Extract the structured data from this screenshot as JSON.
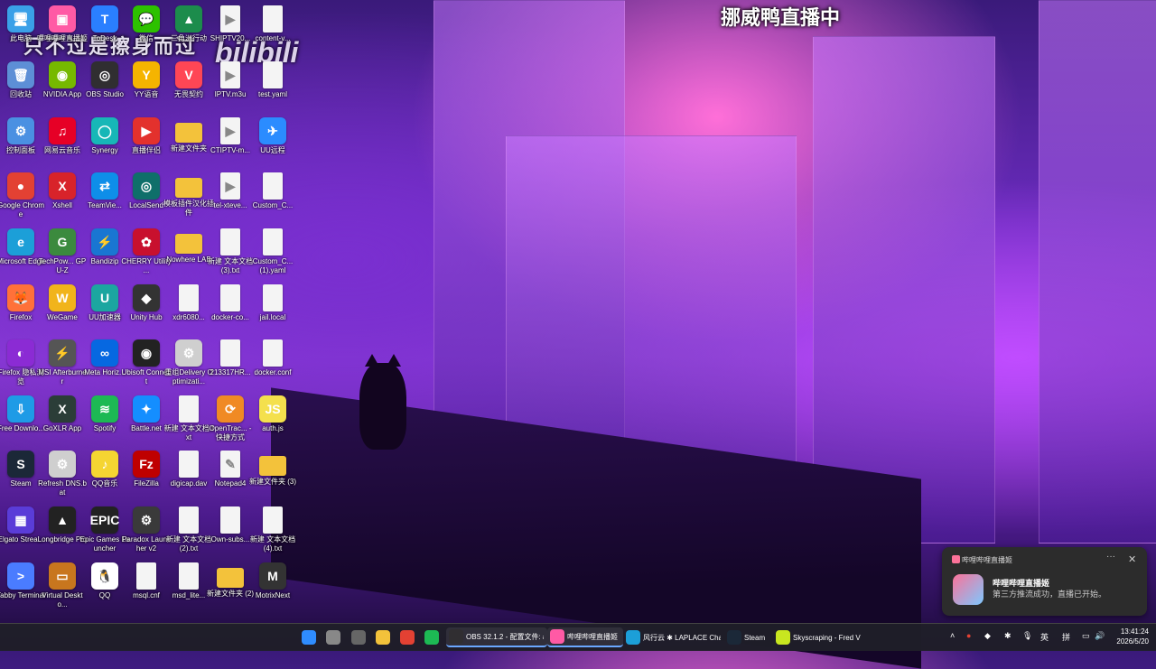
{
  "overlay": {
    "bili_caption": "只不过是擦身而过",
    "bili_logo": "bilibili",
    "live_title": "挪威鸭直播中"
  },
  "desktop_icons": [
    {
      "label": "此电脑",
      "color": "#3aa0e8",
      "glyph": "🖥",
      "type": "app"
    },
    {
      "label": "回收站",
      "color": "#5d8fd6",
      "glyph": "🗑",
      "type": "app"
    },
    {
      "label": "控制面板",
      "color": "#4a90e2",
      "glyph": "⚙",
      "type": "app"
    },
    {
      "label": "Google Chrome",
      "color": "#e34133",
      "glyph": "●",
      "type": "app"
    },
    {
      "label": "Microsoft Edge",
      "color": "#1c9fd8",
      "glyph": "e",
      "type": "app"
    },
    {
      "label": "Firefox",
      "color": "#ff7139",
      "glyph": "🦊",
      "type": "app"
    },
    {
      "label": "Firefox 隐私浏览",
      "color": "#8b2bd4",
      "glyph": "◐",
      "type": "app"
    },
    {
      "label": "Free Downlo...",
      "color": "#1e9be6",
      "glyph": "⇩",
      "type": "app"
    },
    {
      "label": "Steam",
      "color": "#1b2838",
      "glyph": "S",
      "type": "app"
    },
    {
      "label": "Elgato Strea...",
      "color": "#5a3cd8",
      "glyph": "▦",
      "type": "app"
    },
    {
      "label": "Tabby Terminal",
      "color": "#4a7cff",
      "glyph": ">",
      "type": "app"
    },
    {
      "label": "嗶哩嗶哩直播姬",
      "color": "#ff5aa5",
      "glyph": "▣",
      "type": "app"
    },
    {
      "label": "NVIDIA App",
      "color": "#76b900",
      "glyph": "◉",
      "type": "app"
    },
    {
      "label": "网易云音乐",
      "color": "#e60026",
      "glyph": "♫",
      "type": "app"
    },
    {
      "label": "Xshell",
      "color": "#d8232a",
      "glyph": "X",
      "type": "app"
    },
    {
      "label": "TechPow... GPU-Z",
      "color": "#3b8a3e",
      "glyph": "G",
      "type": "app"
    },
    {
      "label": "WeGame",
      "color": "#f1b41b",
      "glyph": "W",
      "type": "app"
    },
    {
      "label": "MSI Afterburner",
      "color": "#555",
      "glyph": "⚡",
      "type": "app"
    },
    {
      "label": "GoXLR App",
      "color": "#2b3d38",
      "glyph": "X",
      "type": "app"
    },
    {
      "label": "Refresh DNS.bat",
      "color": "#cfcfcf",
      "glyph": "⚙",
      "type": "app"
    },
    {
      "label": "Longbridge Pro",
      "color": "#222",
      "glyph": "▲",
      "type": "app"
    },
    {
      "label": "Virtual Deskto...",
      "color": "#c8761e",
      "glyph": "▭",
      "type": "app"
    },
    {
      "label": "ToDesk",
      "color": "#2a7fff",
      "glyph": "T",
      "type": "app"
    },
    {
      "label": "OBS Studio",
      "color": "#302e31",
      "glyph": "◎",
      "type": "app"
    },
    {
      "label": "Synergy",
      "color": "#17b7b7",
      "glyph": "◯",
      "type": "app"
    },
    {
      "label": "TeamVie...",
      "color": "#0e8ee9",
      "glyph": "⇄",
      "type": "app"
    },
    {
      "label": "Bandizip",
      "color": "#1976d2",
      "glyph": "⚡",
      "type": "app"
    },
    {
      "label": "UU加速器",
      "color": "#1ca6a0",
      "glyph": "U",
      "type": "app"
    },
    {
      "label": "Meta Horiz...",
      "color": "#0668e1",
      "glyph": "∞",
      "type": "app"
    },
    {
      "label": "Spotify",
      "color": "#1db954",
      "glyph": "≋",
      "type": "app"
    },
    {
      "label": "QQ音乐",
      "color": "#f5d532",
      "glyph": "♪",
      "type": "app"
    },
    {
      "label": "Epic Games Launcher",
      "color": "#222",
      "glyph": "EPIC",
      "type": "app"
    },
    {
      "label": "QQ",
      "color": "#ffffff",
      "glyph": "🐧",
      "type": "app"
    },
    {
      "label": "微信",
      "color": "#2dc100",
      "glyph": "💬",
      "type": "app"
    },
    {
      "label": "YY语音",
      "color": "#f5b400",
      "glyph": "Y",
      "type": "app"
    },
    {
      "label": "直播伴侣",
      "color": "#e3312d",
      "glyph": "▶",
      "type": "app"
    },
    {
      "label": "LocalSend",
      "color": "#0f6f6a",
      "glyph": "◎",
      "type": "app"
    },
    {
      "label": "CHERRY Utility ...",
      "color": "#c8102e",
      "glyph": "✿",
      "type": "app"
    },
    {
      "label": "Unity Hub",
      "color": "#333",
      "glyph": "◆",
      "type": "app"
    },
    {
      "label": "Ubisoft Connect",
      "color": "#222",
      "glyph": "◉",
      "type": "app"
    },
    {
      "label": "Battle.net",
      "color": "#148eff",
      "glyph": "✦",
      "type": "app"
    },
    {
      "label": "FileZilla",
      "color": "#bf0000",
      "glyph": "Fz",
      "type": "app"
    },
    {
      "label": "Paradox Launcher v2",
      "color": "#3a3a3a",
      "glyph": "⚙",
      "type": "app"
    },
    {
      "label": "msql.cnf",
      "color": "#fff",
      "glyph": "",
      "type": "doc"
    },
    {
      "label": "三角洲行动",
      "color": "#1c8c4c",
      "glyph": "▲",
      "type": "app"
    },
    {
      "label": "无畏契约",
      "color": "#ff4655",
      "glyph": "V",
      "type": "app"
    },
    {
      "label": "新建文件夹",
      "color": "#f3c23b",
      "glyph": "",
      "type": "folder"
    },
    {
      "label": "模板插件汉化插件",
      "color": "#f3c23b",
      "glyph": "",
      "type": "folder"
    },
    {
      "label": "Nowhere LAB",
      "color": "#f3c23b",
      "glyph": "",
      "type": "folder"
    },
    {
      "label": "xdr6080...",
      "color": "#fff",
      "glyph": "",
      "type": "doc"
    },
    {
      "label": "重组Delivery Optimizati...",
      "color": "#cfcfcf",
      "glyph": "⚙",
      "type": "app"
    },
    {
      "label": "新建 文本文档.txt",
      "color": "#fff",
      "glyph": "",
      "type": "doc"
    },
    {
      "label": "digicap.dav",
      "color": "#fff",
      "glyph": "",
      "type": "doc"
    },
    {
      "label": "新建 文本文档 (2).txt",
      "color": "#fff",
      "glyph": "",
      "type": "doc"
    },
    {
      "label": "msd_lite...",
      "color": "#fff",
      "glyph": "",
      "type": "doc"
    },
    {
      "label": "SHIPTV20...",
      "color": "#fff",
      "glyph": "▶",
      "type": "doc"
    },
    {
      "label": "IPTV.m3u",
      "color": "#fff",
      "glyph": "▶",
      "type": "doc"
    },
    {
      "label": "CTIPTV-m...",
      "color": "#fff",
      "glyph": "▶",
      "type": "doc"
    },
    {
      "label": "tel-xteve...",
      "color": "#fff",
      "glyph": "▶",
      "type": "doc"
    },
    {
      "label": "新建 文本文档 (3).txt",
      "color": "#fff",
      "glyph": "",
      "type": "doc"
    },
    {
      "label": "docker-co...",
      "color": "#fff",
      "glyph": "",
      "type": "doc"
    },
    {
      "label": "213317HR...",
      "color": "#fff",
      "glyph": "",
      "type": "doc"
    },
    {
      "label": "OpenTrac... - 快捷方式",
      "color": "#f08a24",
      "glyph": "⟳",
      "type": "app"
    },
    {
      "label": "Notepad4",
      "color": "#fff",
      "glyph": "✎",
      "type": "doc"
    },
    {
      "label": "Own-subs...",
      "color": "#fff",
      "glyph": "",
      "type": "doc"
    },
    {
      "label": "新建文件夹 (2)",
      "color": "#f3c23b",
      "glyph": "",
      "type": "folder"
    },
    {
      "label": "content-v...",
      "color": "#fff",
      "glyph": "",
      "type": "doc"
    },
    {
      "label": "test.yaml",
      "color": "#fff",
      "glyph": "",
      "type": "doc"
    },
    {
      "label": "UU远程",
      "color": "#2b8cff",
      "glyph": "✈",
      "type": "app"
    },
    {
      "label": "Custom_C...",
      "color": "#fff",
      "glyph": "",
      "type": "doc"
    },
    {
      "label": "Custom_C... (1).yaml",
      "color": "#fff",
      "glyph": "",
      "type": "doc"
    },
    {
      "label": "jail.local",
      "color": "#fff",
      "glyph": "",
      "type": "doc"
    },
    {
      "label": "docker.conf",
      "color": "#fff",
      "glyph": "",
      "type": "doc"
    },
    {
      "label": "auth.js",
      "color": "#f4e04d",
      "glyph": "JS",
      "type": "app"
    },
    {
      "label": "新建文件夹 (3)",
      "color": "#f3c23b",
      "glyph": "",
      "type": "folder"
    },
    {
      "label": "新建 文本文档 (4).txt",
      "color": "#fff",
      "glyph": "",
      "type": "doc"
    },
    {
      "label": "MotrixNext",
      "color": "#333",
      "glyph": "M",
      "type": "app"
    }
  ],
  "toast": {
    "app_name": "哔哩哔哩直播姬",
    "more": "···",
    "close": "✕",
    "title": "哔哩哔哩直播姬",
    "body": "第三方推流成功，直播已开始。"
  },
  "taskbar": {
    "pinned": [
      {
        "name": "start",
        "color": "#2f8cff"
      },
      {
        "name": "search",
        "color": "#888"
      },
      {
        "name": "task-view",
        "color": "#666"
      },
      {
        "name": "file-explorer",
        "color": "#f3c23b"
      },
      {
        "name": "chrome",
        "color": "#e34133"
      },
      {
        "name": "spotify",
        "color": "#1db954"
      }
    ],
    "apps": [
      {
        "label": "OBS 32.1.2 - 配置文件: #",
        "color": "#302e31",
        "active": true
      },
      {
        "label": "哔哩哔哩直播姬",
        "color": "#ff5aa5",
        "active": true
      },
      {
        "label": "风行云 ✱ LAPLACE Chat",
        "color": "#1c9fd8",
        "active": false
      },
      {
        "label": "Steam",
        "color": "#1b2838",
        "active": false
      },
      {
        "label": "Skyscraping - Fred V",
        "color": "#c8e620",
        "active": false
      }
    ],
    "tray": {
      "ime1": "英",
      "ime2": "拼",
      "time": "13:41:24",
      "date": "2026/5/20"
    }
  }
}
